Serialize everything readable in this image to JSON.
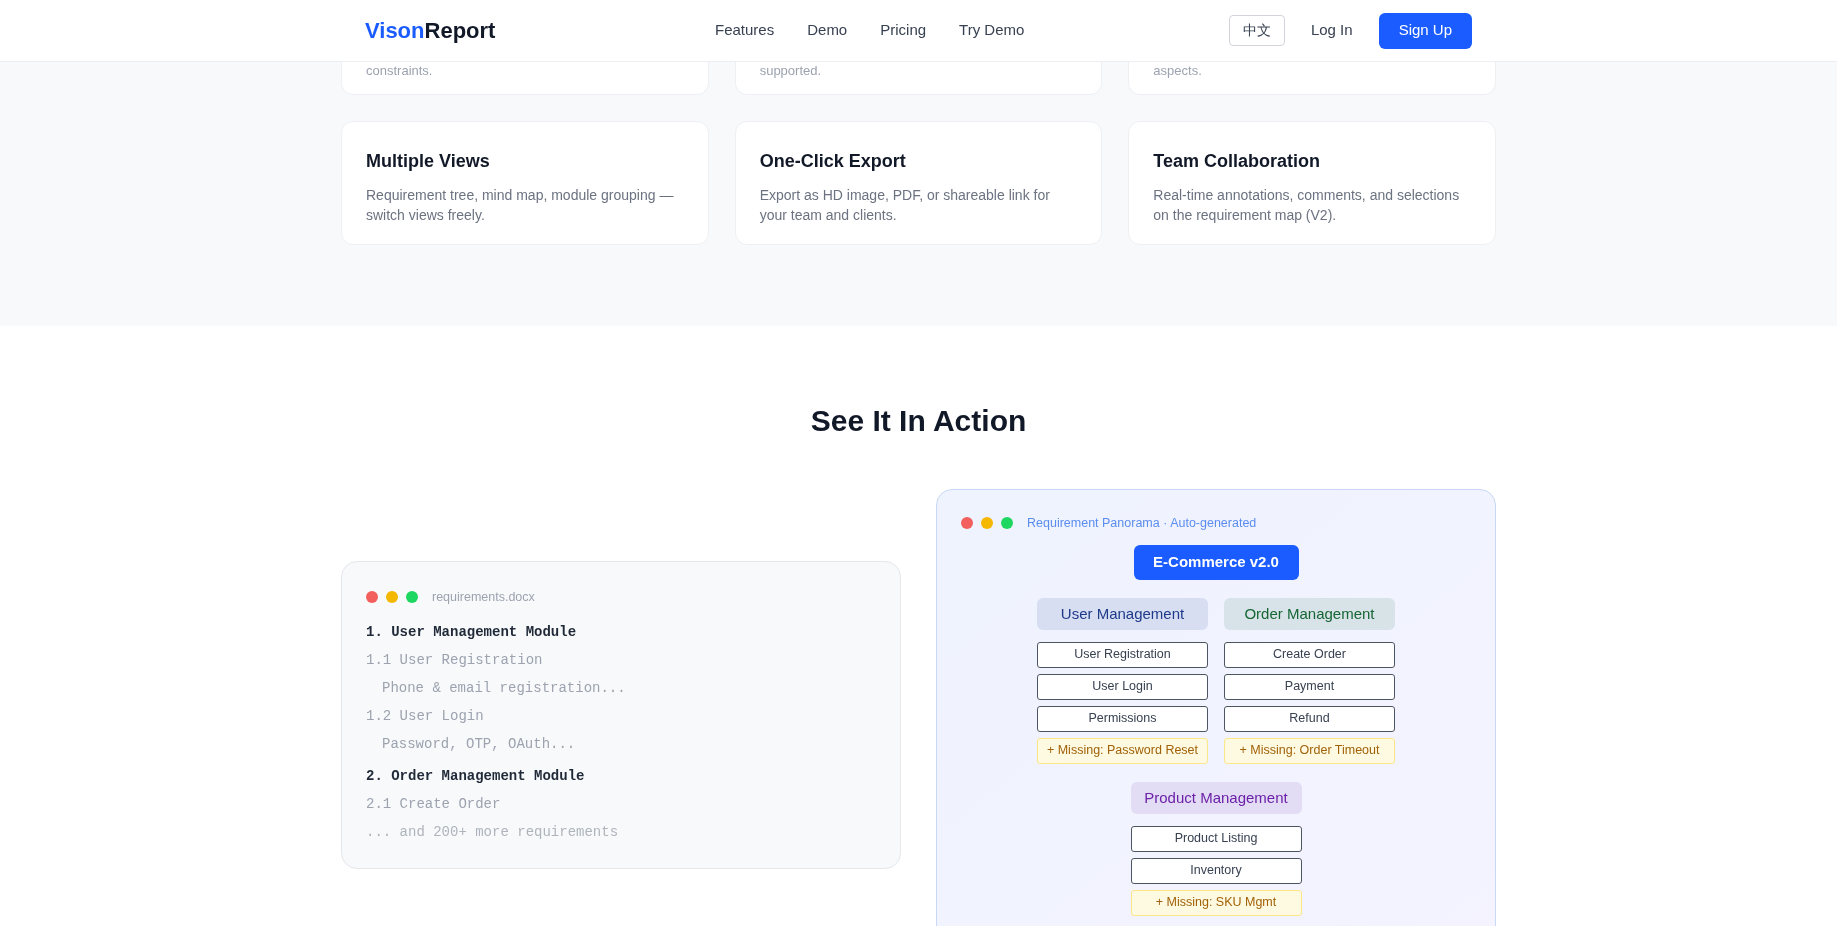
{
  "nav": {
    "logo_accent": "Vison",
    "logo_rest": "Report",
    "links": [
      "Features",
      "Demo",
      "Pricing",
      "Try Demo"
    ],
    "language": "中文",
    "login": "Log In",
    "signup": "Sign Up"
  },
  "features_partial": [
    "constraints.",
    "supported.",
    "aspects."
  ],
  "features": [
    {
      "title": "Multiple Views",
      "text": "Requirement tree, mind map, module grouping — switch views freely."
    },
    {
      "title": "One-Click Export",
      "text": "Export as HD image, PDF, or shareable link for your team and clients."
    },
    {
      "title": "Team Collaboration",
      "text": "Real-time annotations, comments, and selections on the requirement map (V2)."
    }
  ],
  "demo": {
    "title": "See It In Action",
    "document": {
      "filename": "requirements.docx",
      "lines": [
        {
          "kind": "heading",
          "text": "1. User Management Module"
        },
        {
          "kind": "sub",
          "text": "1.1 User Registration"
        },
        {
          "kind": "detail",
          "text": "Phone & email registration..."
        },
        {
          "kind": "sub",
          "text": "1.2 User Login"
        },
        {
          "kind": "detail",
          "text": "Password, OTP, OAuth..."
        },
        {
          "kind": "heading",
          "text": "2. Order Management Module"
        },
        {
          "kind": "sub",
          "text": "2.1 Create Order"
        },
        {
          "kind": "more",
          "text": "... and 200+ more requirements"
        }
      ]
    },
    "panorama": {
      "caption": "Requirement Panorama · Auto-generated",
      "root": "E-Commerce v2.0",
      "rows": [
        [
          {
            "name": "User Management",
            "color": "#1e3a8a",
            "items": [
              {
                "kind": "requirement",
                "text": "User Registration"
              },
              {
                "kind": "requirement",
                "text": "User Login"
              },
              {
                "kind": "requirement",
                "text": "Permissions"
              },
              {
                "kind": "missing",
                "text": "+ Missing: Password Reset"
              }
            ]
          },
          {
            "name": "Order Management",
            "color": "#166534",
            "items": [
              {
                "kind": "requirement",
                "text": "Create Order"
              },
              {
                "kind": "requirement",
                "text": "Payment"
              },
              {
                "kind": "requirement",
                "text": "Refund"
              },
              {
                "kind": "missing",
                "text": "+ Missing: Order Timeout"
              }
            ]
          }
        ],
        [
          {
            "name": "Product Management",
            "color": "#6b21a8",
            "items": [
              {
                "kind": "requirement",
                "text": "Product Listing"
              },
              {
                "kind": "requirement",
                "text": "Inventory"
              },
              {
                "kind": "missing",
                "text": "+ Missing: SKU Mgmt"
              }
            ]
          }
        ]
      ]
    }
  }
}
